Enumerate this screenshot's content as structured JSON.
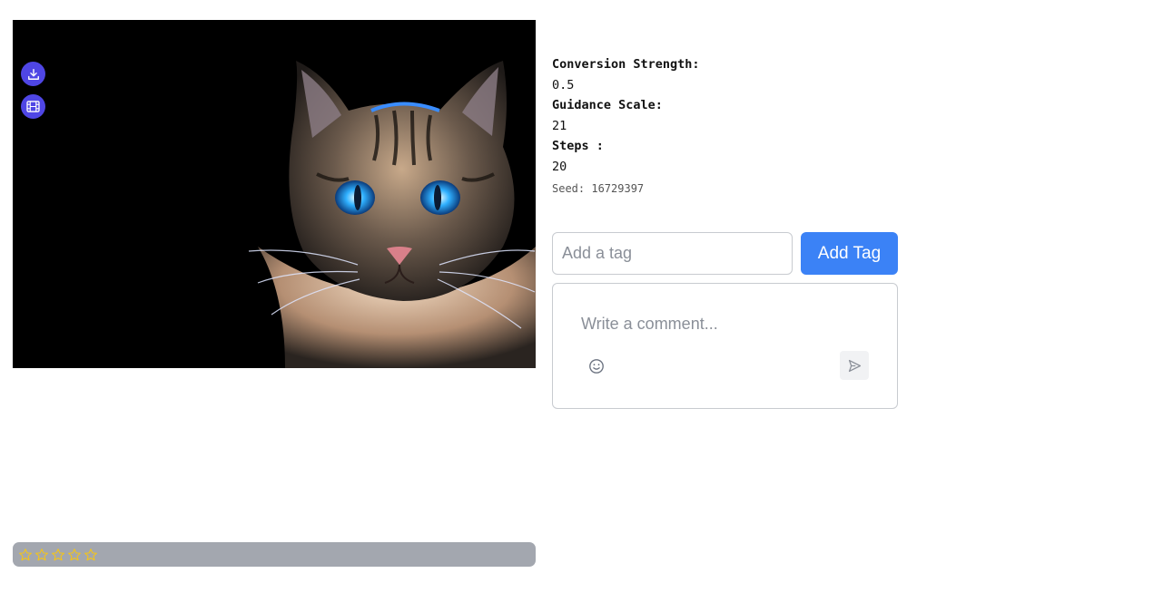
{
  "image": {
    "subject": "cat portrait artwork",
    "download_icon": "download-icon",
    "video_icon": "film-icon"
  },
  "params": {
    "conversion_strength_label": "Conversion Strength:",
    "conversion_strength_value": "0.5",
    "guidance_scale_label": "Guidance Scale:",
    "guidance_scale_value": "21",
    "steps_label": "Steps :",
    "steps_value": "20",
    "seed": "Seed: 16729397"
  },
  "tags": {
    "placeholder": "Add a tag",
    "button_label": "Add Tag"
  },
  "comment": {
    "placeholder": "Write a comment...",
    "emoji_icon": "smile-icon",
    "send_icon": "send-icon"
  },
  "rating": {
    "value": 0,
    "max": 5,
    "star_color": "#f5c518"
  },
  "colors": {
    "accent": "#3b82f6",
    "overlay_button": "#4f46e5",
    "rating_bar": "#a3a7af"
  }
}
